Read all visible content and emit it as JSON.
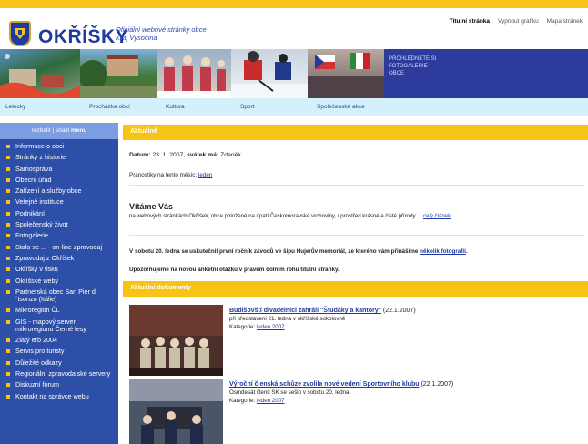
{
  "site": {
    "name": "OKŘÍŠKY",
    "subtitle_line1": "Oficiální webové stránky obce",
    "subtitle_line2": "Kraj Vysočina"
  },
  "toplinks": [
    "Titulní stránka",
    "Vypnout grafiku",
    "Mapa stránek"
  ],
  "banner": {
    "promo_line1": "Prohlédněte si",
    "promo_line2": "fotogalerie",
    "promo_line3": "obce"
  },
  "nav": [
    "Letecky",
    "Procházka obcí",
    "Kultura",
    "Sport",
    "Společenské akce"
  ],
  "sidebar": {
    "head_part1": "rozbalit | sbalit",
    "head_part2": "menu",
    "items": [
      "Informace o obci",
      "Stránky z historie",
      "Samospráva",
      "Obecní úřad",
      "Zařízení a služby obce",
      "Veřejné instituce",
      "Podnikání",
      "Společenský život",
      "Fotogalerie",
      "Stalo se ... - on-line zpravodaj",
      "Zpravodaj z Okříšek",
      "Okříšky v tisku",
      "Okříšské weby",
      "Partnerská obec San Pier d´Isonzo (Itálie)",
      "Mikroregion ČL",
      "GIS - mapový server mikroregionu Černé lesy",
      "Zlatý erb 2004",
      "Servis pro turisty",
      "Důležité odkazy",
      "Regionální zpravodajské servery",
      "Diskuzní fórum",
      "Kontakt na správce webu"
    ]
  },
  "main": {
    "aktualne_title": "Aktuálně",
    "date_label": "Datum:",
    "date_value": "23. 1. 2007,",
    "nameday_label": "svátek má:",
    "nameday_value": "Zdeněk",
    "pranostiky_text": "Pranostiky na tento měsíc:",
    "pranostiky_link": "leden",
    "welcome_title": "Vítáme Vás",
    "welcome_text": "na webových stránkách Okříšek, obce položené na úpatí Českomoravské vrchoviny, uprostřed krásné a čisté přírody ...",
    "welcome_link": "celý článek",
    "notice1_text": "V sobotu 20. ledna se uskutečnil první ročník závodů ve šipu Hujerův memoriál, ze kterého vám přinášíme",
    "notice1_link": "několik fotografií",
    "notice1_end": ".",
    "notice2_text": "Upozorňujeme na novou anketní otázku v pravém dolním rohu titulní stránky.",
    "docs_title": "Aktuální dokumenty",
    "docs": [
      {
        "title": "Budišovští divadelníci zahráli \"Študáky a kantory\"",
        "date": "(22.1.2007)",
        "desc": "při představení 21. ledna v okříšské sokolovně",
        "category_label": "Kategorie:",
        "category": "leden 2007"
      },
      {
        "title": "Výroční členská schůze zvolila nové vedení Sportovního klubu",
        "date": "(22.1.2007)",
        "desc": "Osmdesát členů SK se sešlo v sobotu 20. ledna",
        "category_label": "Kategorie:",
        "category": "leden 2007"
      }
    ]
  },
  "colors": {
    "accent_yellow": "#f7c416",
    "brand_blue": "#2d3c9c",
    "sidebar_blue": "#2d4fa8",
    "nav_light": "#d4f0fb"
  }
}
